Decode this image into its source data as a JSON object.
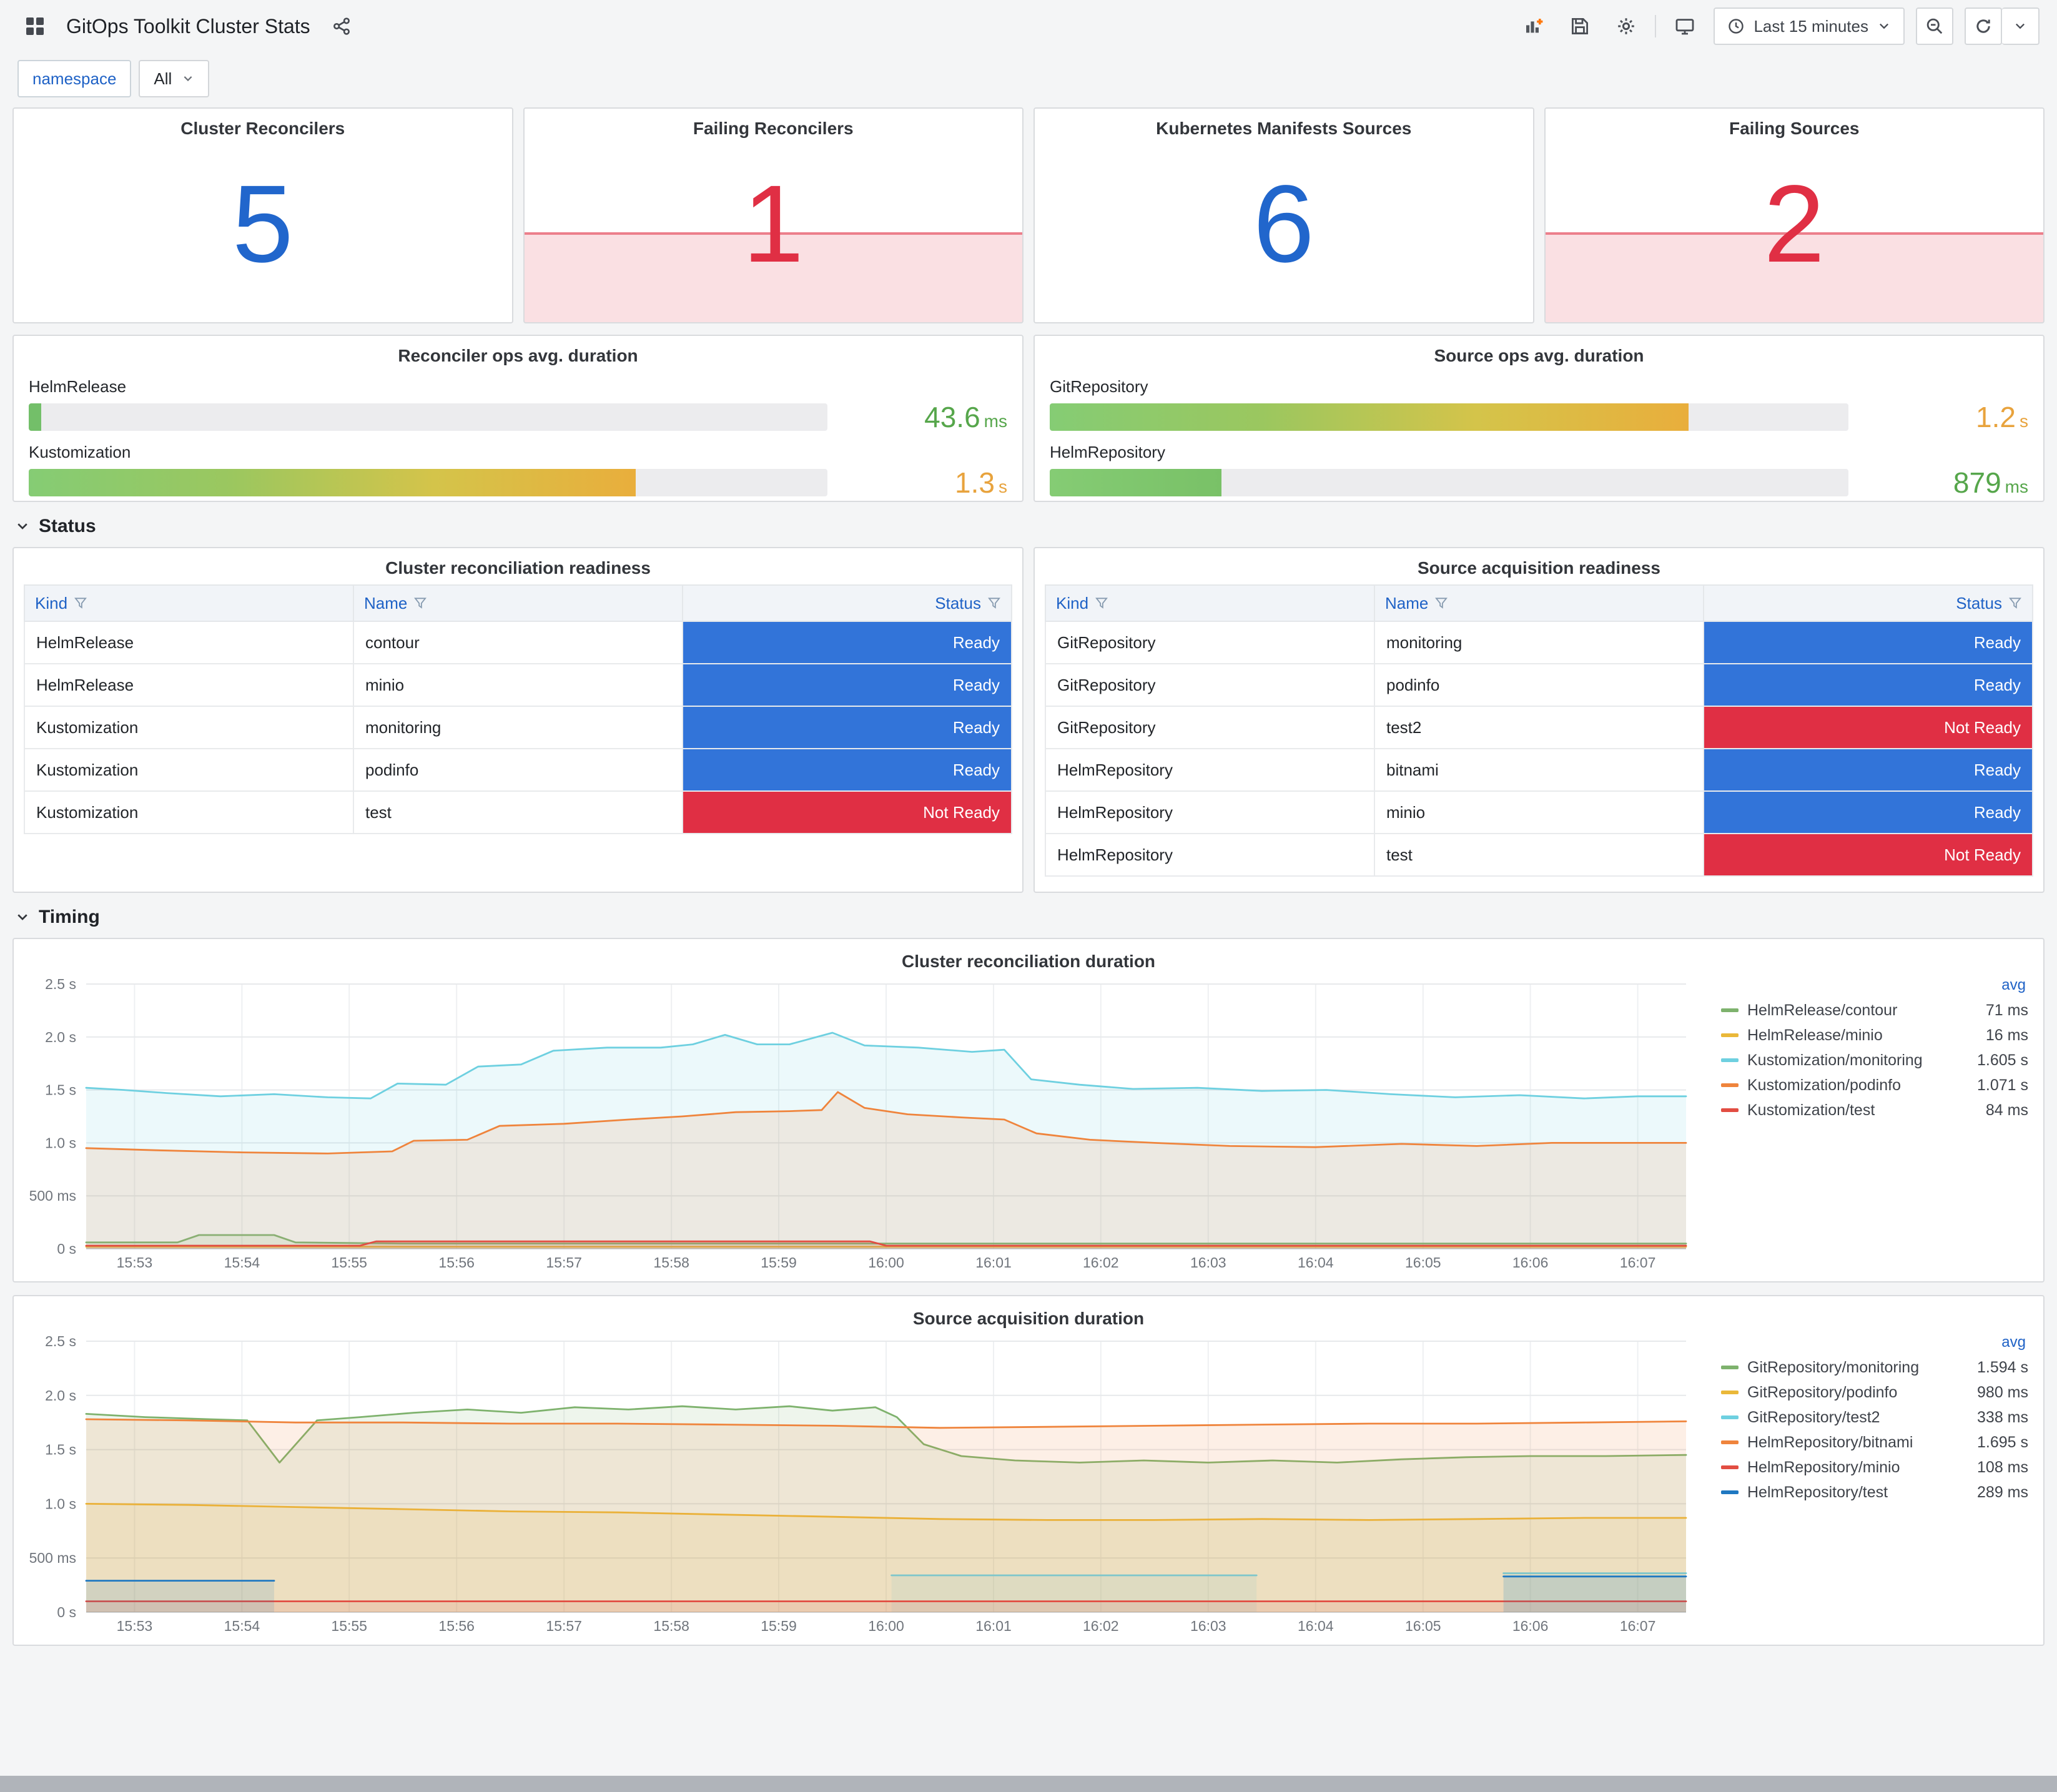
{
  "theme": {
    "accent_blue": "#3274D9",
    "stat_blue": "#2166CC",
    "alert_red": "#E02F44",
    "alert_fill": "rgba(224,47,68,0.15)",
    "ready_bg": "#3274D9",
    "not_ready_bg": "#E02F44",
    "header_link_blue": "#1F62C6"
  },
  "header": {
    "title": "GitOps Toolkit Cluster Stats",
    "time_range_label": "Last 15 minutes"
  },
  "variables": {
    "label": "namespace",
    "value": "All"
  },
  "stats": [
    {
      "title": "Cluster Reconcilers",
      "value": "5",
      "state": "ok"
    },
    {
      "title": "Failing Reconcilers",
      "value": "1",
      "state": "alert"
    },
    {
      "title": "Kubernetes Manifests Sources",
      "value": "6",
      "state": "ok"
    },
    {
      "title": "Failing Sources",
      "value": "2",
      "state": "alert"
    }
  ],
  "gauges": [
    {
      "title": "Reconciler ops avg. duration",
      "bars": [
        {
          "label": "HelmRelease",
          "value": "43.6",
          "unit": "ms",
          "pct": 1.6,
          "value_color": "#56A64B",
          "fill_colors": [
            "#73BF69",
            "#73BF69"
          ]
        },
        {
          "label": "Kustomization",
          "value": "1.3",
          "unit": "s",
          "pct": 76,
          "value_color": "#E8A33D",
          "fill_colors": [
            "#85CC74",
            "#9BC75F",
            "#D4C44A",
            "#E9AE3C"
          ]
        }
      ]
    },
    {
      "title": "Source ops avg. duration",
      "bars": [
        {
          "label": "GitRepository",
          "value": "1.2",
          "unit": "s",
          "pct": 80,
          "value_color": "#E8A33D",
          "fill_colors": [
            "#85CC74",
            "#9BC75F",
            "#D4C44A",
            "#E9AE3C"
          ]
        },
        {
          "label": "HelmRepository",
          "value": "879",
          "unit": "ms",
          "pct": 21.5,
          "value_color": "#56A64B",
          "fill_colors": [
            "#85CC74",
            "#79C167"
          ]
        }
      ]
    }
  ],
  "sections": {
    "status": "Status",
    "timing": "Timing"
  },
  "tables": [
    {
      "title": "Cluster reconciliation readiness",
      "columns": [
        "Kind",
        "Name",
        "Status"
      ],
      "rows": [
        [
          "HelmRelease",
          "contour",
          "Ready"
        ],
        [
          "HelmRelease",
          "minio",
          "Ready"
        ],
        [
          "Kustomization",
          "monitoring",
          "Ready"
        ],
        [
          "Kustomization",
          "podinfo",
          "Ready"
        ],
        [
          "Kustomization",
          "test",
          "Not Ready"
        ]
      ]
    },
    {
      "title": "Source acquisition readiness",
      "columns": [
        "Kind",
        "Name",
        "Status"
      ],
      "rows": [
        [
          "GitRepository",
          "monitoring",
          "Ready"
        ],
        [
          "GitRepository",
          "podinfo",
          "Ready"
        ],
        [
          "GitRepository",
          "test2",
          "Not Ready"
        ],
        [
          "HelmRepository",
          "bitnami",
          "Ready"
        ],
        [
          "HelmRepository",
          "minio",
          "Ready"
        ],
        [
          "HelmRepository",
          "test",
          "Not Ready"
        ]
      ]
    }
  ],
  "legend_header": "avg",
  "chart_data": [
    {
      "type": "line",
      "title": "Cluster reconciliation duration",
      "x_domain": [
        0.55,
        15.45
      ],
      "y_domain": [
        0,
        2.5
      ],
      "x_tick_labels": [
        "15:53",
        "15:54",
        "15:55",
        "15:56",
        "15:57",
        "15:58",
        "15:59",
        "16:00",
        "16:01",
        "16:02",
        "16:03",
        "16:04",
        "16:05",
        "16:06",
        "16:07"
      ],
      "y_ticks": [
        {
          "y": 0,
          "label": "0 s"
        },
        {
          "y": 0.5,
          "label": "500 ms"
        },
        {
          "y": 1,
          "label": "1.0 s"
        },
        {
          "y": 1.5,
          "label": "1.5 s"
        },
        {
          "y": 2,
          "label": "2.0 s"
        },
        {
          "y": 2.5,
          "label": "2.5 s"
        }
      ],
      "series": [
        {
          "name": "HelmRelease/contour",
          "color": "#7EB26D",
          "avg": "71 ms",
          "segments": [
            [
              [
                0.55,
                0.06
              ],
              [
                1.4,
                0.06
              ],
              [
                1.6,
                0.13
              ],
              [
                2.3,
                0.13
              ],
              [
                2.5,
                0.06
              ],
              [
                3.5,
                0.05
              ],
              [
                6,
                0.05
              ],
              [
                9,
                0.05
              ],
              [
                12,
                0.05
              ],
              [
                15.45,
                0.05
              ]
            ]
          ]
        },
        {
          "name": "HelmRelease/minio",
          "color": "#EAB839",
          "avg": "16 ms",
          "segments": [
            [
              [
                0.55,
                0.02
              ],
              [
                15.45,
                0.02
              ]
            ]
          ]
        },
        {
          "name": "Kustomization/monitoring",
          "color": "#6ED0E0",
          "avg": "1.605 s",
          "segments": [
            [
              [
                0.55,
                1.52
              ],
              [
                0.9,
                1.5
              ],
              [
                1.3,
                1.47
              ],
              [
                1.8,
                1.44
              ],
              [
                2.3,
                1.46
              ],
              [
                2.8,
                1.43
              ],
              [
                3.2,
                1.42
              ],
              [
                3.45,
                1.56
              ],
              [
                3.9,
                1.55
              ],
              [
                4.2,
                1.72
              ],
              [
                4.6,
                1.74
              ],
              [
                4.9,
                1.87
              ],
              [
                5.4,
                1.9
              ],
              [
                5.9,
                1.9
              ],
              [
                6.2,
                1.93
              ],
              [
                6.5,
                2.02
              ],
              [
                6.8,
                1.93
              ],
              [
                7.1,
                1.93
              ],
              [
                7.5,
                2.04
              ],
              [
                7.8,
                1.92
              ],
              [
                8.3,
                1.9
              ],
              [
                8.8,
                1.86
              ],
              [
                9.1,
                1.88
              ],
              [
                9.35,
                1.6
              ],
              [
                9.8,
                1.55
              ],
              [
                10.3,
                1.51
              ],
              [
                10.9,
                1.52
              ],
              [
                11.5,
                1.49
              ],
              [
                12.1,
                1.5
              ],
              [
                12.7,
                1.46
              ],
              [
                13.3,
                1.43
              ],
              [
                13.9,
                1.45
              ],
              [
                14.5,
                1.42
              ],
              [
                15,
                1.44
              ],
              [
                15.45,
                1.44
              ]
            ]
          ]
        },
        {
          "name": "Kustomization/podinfo",
          "color": "#EF843C",
          "avg": "1.071 s",
          "segments": [
            [
              [
                0.55,
                0.95
              ],
              [
                1.2,
                0.93
              ],
              [
                2,
                0.91
              ],
              [
                2.8,
                0.9
              ],
              [
                3.4,
                0.92
              ],
              [
                3.6,
                1.02
              ],
              [
                4.1,
                1.03
              ],
              [
                4.4,
                1.16
              ],
              [
                5,
                1.18
              ],
              [
                5.6,
                1.22
              ],
              [
                6.1,
                1.25
              ],
              [
                6.6,
                1.29
              ],
              [
                7.1,
                1.3
              ],
              [
                7.4,
                1.31
              ],
              [
                7.55,
                1.48
              ],
              [
                7.8,
                1.33
              ],
              [
                8.2,
                1.27
              ],
              [
                8.7,
                1.24
              ],
              [
                9.1,
                1.22
              ],
              [
                9.4,
                1.09
              ],
              [
                9.9,
                1.03
              ],
              [
                10.5,
                1.0
              ],
              [
                11.2,
                0.97
              ],
              [
                12,
                0.96
              ],
              [
                12.8,
                0.99
              ],
              [
                13.5,
                0.97
              ],
              [
                14.2,
                1.0
              ],
              [
                15.45,
                1.0
              ]
            ]
          ]
        },
        {
          "name": "Kustomization/test",
          "color": "#E24D42",
          "avg": "84 ms",
          "segments": [
            [
              [
                0.55,
                0.03
              ],
              [
                3.1,
                0.03
              ],
              [
                3.25,
                0.07
              ],
              [
                7.85,
                0.07
              ],
              [
                8,
                0.03
              ],
              [
                15.45,
                0.03
              ]
            ]
          ]
        }
      ]
    },
    {
      "type": "line",
      "title": "Source acquisition duration",
      "x_domain": [
        0.55,
        15.45
      ],
      "y_domain": [
        0,
        2.5
      ],
      "x_tick_labels": [
        "15:53",
        "15:54",
        "15:55",
        "15:56",
        "15:57",
        "15:58",
        "15:59",
        "16:00",
        "16:01",
        "16:02",
        "16:03",
        "16:04",
        "16:05",
        "16:06",
        "16:07"
      ],
      "y_ticks": [
        {
          "y": 0,
          "label": "0 s"
        },
        {
          "y": 0.5,
          "label": "500 ms"
        },
        {
          "y": 1,
          "label": "1.0 s"
        },
        {
          "y": 1.5,
          "label": "1.5 s"
        },
        {
          "y": 2,
          "label": "2.0 s"
        },
        {
          "y": 2.5,
          "label": "2.5 s"
        }
      ],
      "series": [
        {
          "name": "GitRepository/monitoring",
          "color": "#7EB26D",
          "avg": "1.594 s",
          "segments": [
            [
              [
                0.55,
                1.83
              ],
              [
                1.1,
                1.8
              ],
              [
                1.7,
                1.78
              ],
              [
                2.05,
                1.77
              ],
              [
                2.35,
                1.38
              ],
              [
                2.7,
                1.77
              ],
              [
                3.1,
                1.8
              ],
              [
                3.6,
                1.84
              ],
              [
                4.1,
                1.87
              ],
              [
                4.6,
                1.84
              ],
              [
                5.1,
                1.89
              ],
              [
                5.6,
                1.87
              ],
              [
                6.1,
                1.9
              ],
              [
                6.6,
                1.87
              ],
              [
                7.1,
                1.9
              ],
              [
                7.5,
                1.86
              ],
              [
                7.9,
                1.89
              ],
              [
                8.1,
                1.8
              ],
              [
                8.35,
                1.55
              ],
              [
                8.7,
                1.44
              ],
              [
                9.2,
                1.4
              ],
              [
                9.8,
                1.38
              ],
              [
                10.4,
                1.4
              ],
              [
                11,
                1.38
              ],
              [
                11.6,
                1.4
              ],
              [
                12.2,
                1.38
              ],
              [
                12.8,
                1.41
              ],
              [
                13.4,
                1.43
              ],
              [
                14,
                1.44
              ],
              [
                14.7,
                1.44
              ],
              [
                15.45,
                1.45
              ]
            ]
          ]
        },
        {
          "name": "GitRepository/podinfo",
          "color": "#EAB839",
          "avg": "980 ms",
          "segments": [
            [
              [
                0.55,
                1.0
              ],
              [
                1.5,
                0.99
              ],
              [
                2.5,
                0.97
              ],
              [
                3.5,
                0.95
              ],
              [
                4.5,
                0.93
              ],
              [
                5.5,
                0.92
              ],
              [
                6.5,
                0.9
              ],
              [
                7.5,
                0.88
              ],
              [
                8.5,
                0.86
              ],
              [
                9.5,
                0.85
              ],
              [
                10.5,
                0.85
              ],
              [
                11.5,
                0.86
              ],
              [
                12.5,
                0.85
              ],
              [
                13.5,
                0.86
              ],
              [
                14.5,
                0.87
              ],
              [
                15.45,
                0.87
              ]
            ]
          ]
        },
        {
          "name": "GitRepository/test2",
          "color": "#6ED0E0",
          "avg": "338 ms",
          "segments": [
            [
              [
                8.05,
                0.34
              ],
              [
                11.45,
                0.34
              ]
            ],
            [
              [
                13.75,
                0.36
              ],
              [
                15.45,
                0.36
              ]
            ]
          ]
        },
        {
          "name": "HelmRepository/bitnami",
          "color": "#EF843C",
          "avg": "1.695 s",
          "segments": [
            [
              [
                0.55,
                1.78
              ],
              [
                1.5,
                1.77
              ],
              [
                2.5,
                1.75
              ],
              [
                3.5,
                1.75
              ],
              [
                4.5,
                1.74
              ],
              [
                5.5,
                1.74
              ],
              [
                6.5,
                1.73
              ],
              [
                7.5,
                1.72
              ],
              [
                8.5,
                1.7
              ],
              [
                9.5,
                1.71
              ],
              [
                10.5,
                1.72
              ],
              [
                11.5,
                1.73
              ],
              [
                12.5,
                1.74
              ],
              [
                13.5,
                1.74
              ],
              [
                14.5,
                1.75
              ],
              [
                15.45,
                1.76
              ]
            ]
          ]
        },
        {
          "name": "HelmRepository/minio",
          "color": "#E24D42",
          "avg": "108 ms",
          "segments": [
            [
              [
                0.55,
                0.1
              ],
              [
                15.45,
                0.1
              ]
            ]
          ]
        },
        {
          "name": "HelmRepository/test",
          "color": "#1F78C1",
          "avg": "289 ms",
          "segments": [
            [
              [
                0.55,
                0.29
              ],
              [
                2.3,
                0.29
              ]
            ],
            [
              [
                13.75,
                0.33
              ],
              [
                15.45,
                0.33
              ]
            ]
          ]
        }
      ]
    }
  ]
}
